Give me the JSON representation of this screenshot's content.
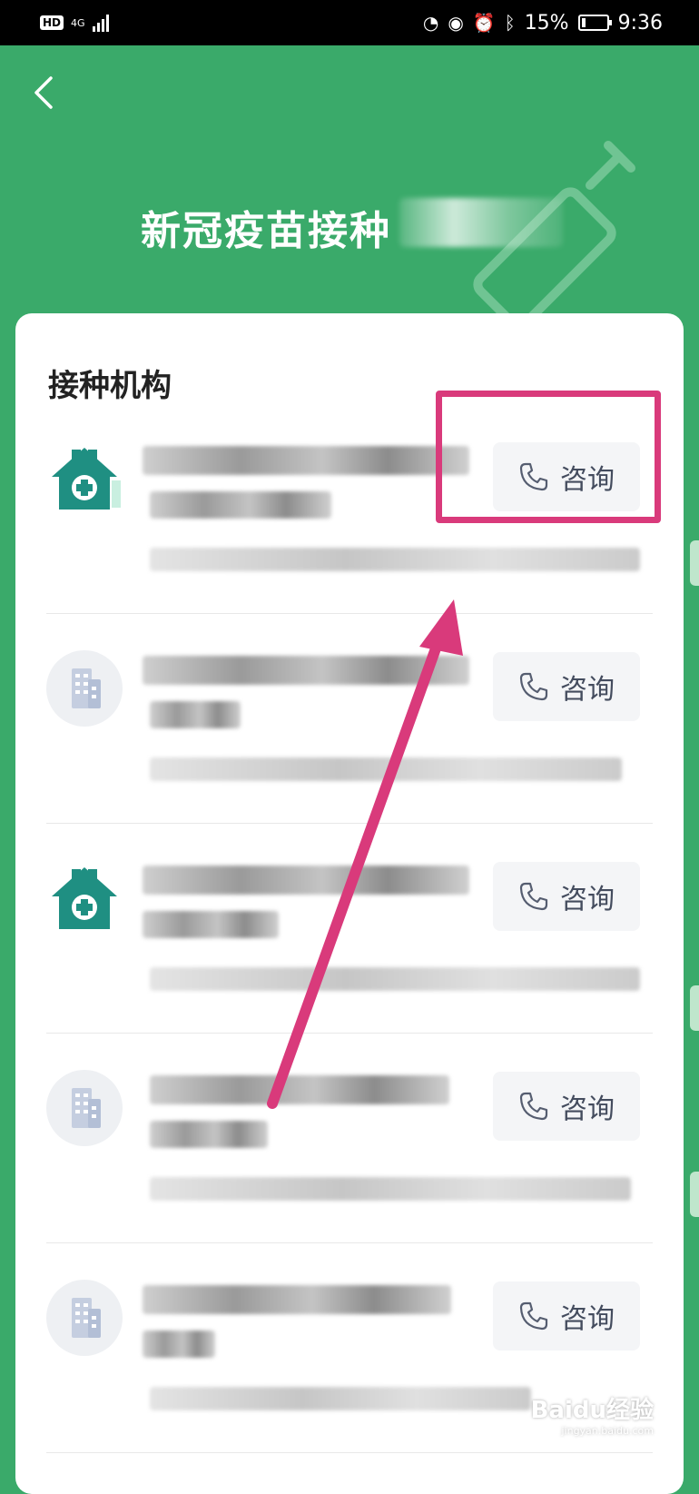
{
  "status_bar": {
    "hd": "HD",
    "network": "4G",
    "battery_percent": "15%",
    "battery_level": 0.15,
    "time": "9:36"
  },
  "header": {
    "title": "新冠疫苗接种"
  },
  "section": {
    "title": "接种机构"
  },
  "institutions": [
    {
      "icon": "clinic-icon",
      "consult_label": "咨询"
    },
    {
      "icon": "building-icon",
      "consult_label": "咨询"
    },
    {
      "icon": "clinic-icon",
      "consult_label": "咨询"
    },
    {
      "icon": "building-icon",
      "consult_label": "咨询"
    },
    {
      "icon": "building-icon",
      "consult_label": "咨询"
    }
  ],
  "watermark": {
    "brand": "Baidu经验",
    "url": "jingyan.baidu.com"
  },
  "colors": {
    "header_green": "#3aaa6a",
    "clinic_teal": "#1f8f82",
    "highlight_pink": "#d93a7b",
    "button_bg": "#f4f5f7",
    "button_text": "#444c5e"
  }
}
